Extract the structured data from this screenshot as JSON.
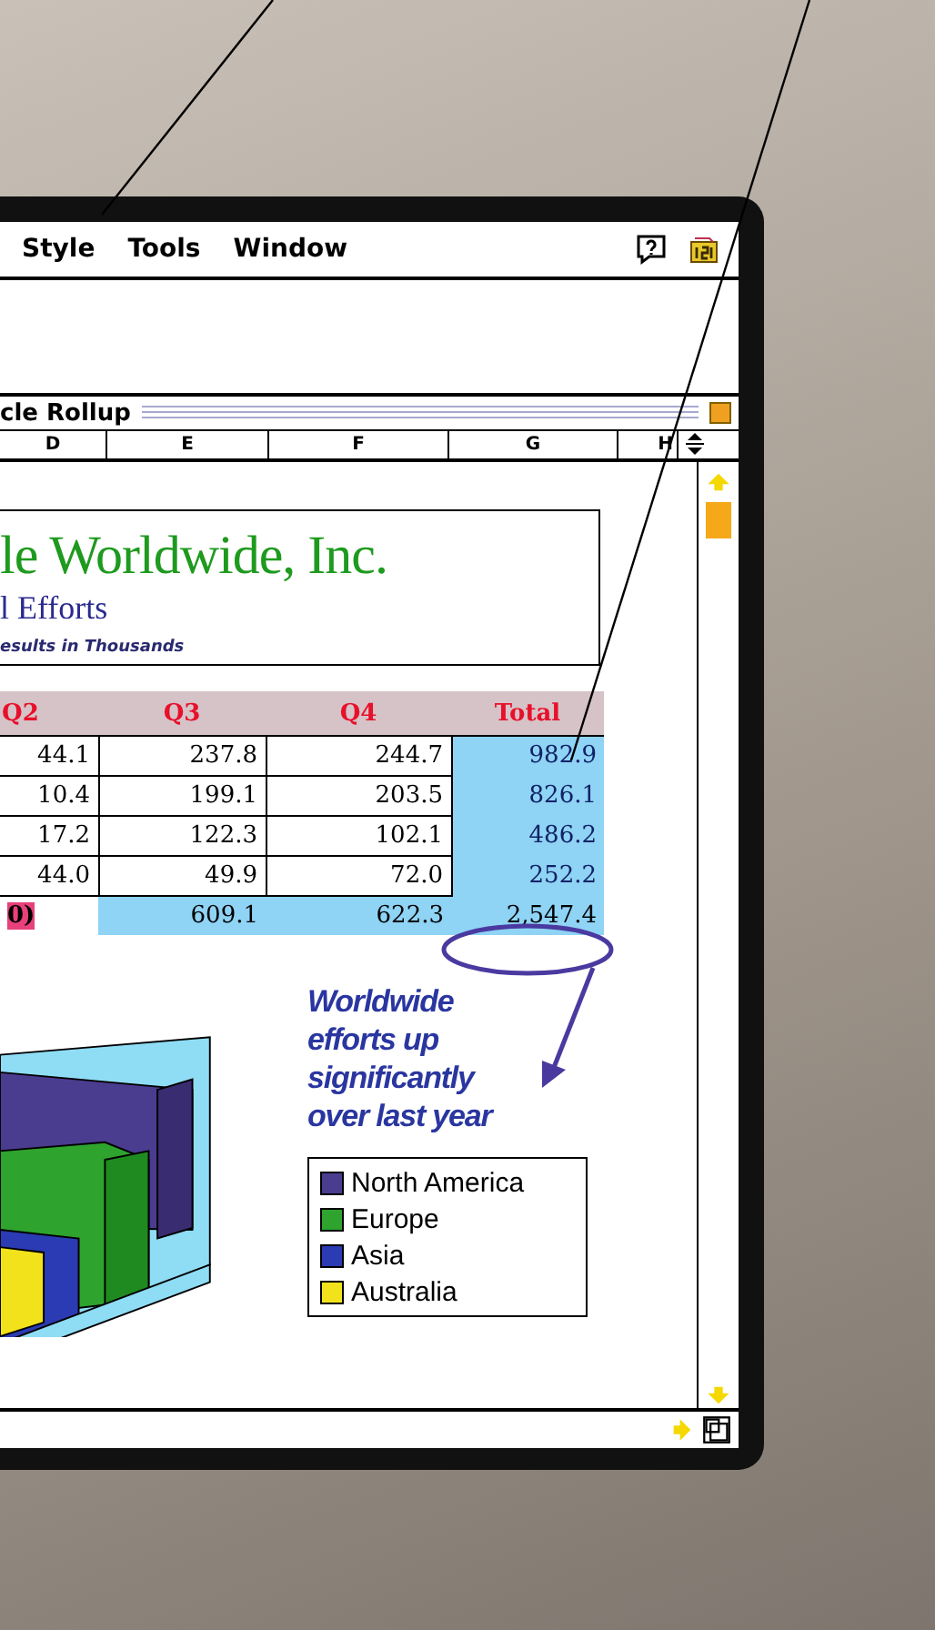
{
  "menu": [
    {
      "label": "Style"
    },
    {
      "label": "Tools"
    },
    {
      "label": "Window"
    }
  ],
  "window": {
    "title": "cle Rollup",
    "columns": [
      "D",
      "E",
      "F",
      "G",
      "H"
    ]
  },
  "report": {
    "title": "le Worldwide, Inc.",
    "subtitle": "l Efforts",
    "note": "esults in Thousands"
  },
  "table": {
    "columns": [
      "Q2",
      "Q3",
      "Q4",
      "Total"
    ],
    "rows": [
      [
        "44.1",
        "237.8",
        "244.7",
        "982.9"
      ],
      [
        "10.4",
        "199.1",
        "203.5",
        "826.1"
      ],
      [
        "17.2",
        "122.3",
        "102.1",
        "486.2"
      ],
      [
        "44.0",
        "49.9",
        "72.0",
        "252.2"
      ]
    ],
    "totals": [
      "0)",
      "609.1",
      "622.3",
      "2,547.4"
    ]
  },
  "callout": "Worldwide\nefforts up\nsignificantly\nover last year",
  "legend": [
    {
      "label": "North America",
      "color": "#4a3c8e"
    },
    {
      "label": "Europe",
      "color": "#2ea32e"
    },
    {
      "label": "Asia",
      "color": "#2b3bb3"
    },
    {
      "label": "Australia",
      "color": "#f2e21c"
    }
  ]
}
